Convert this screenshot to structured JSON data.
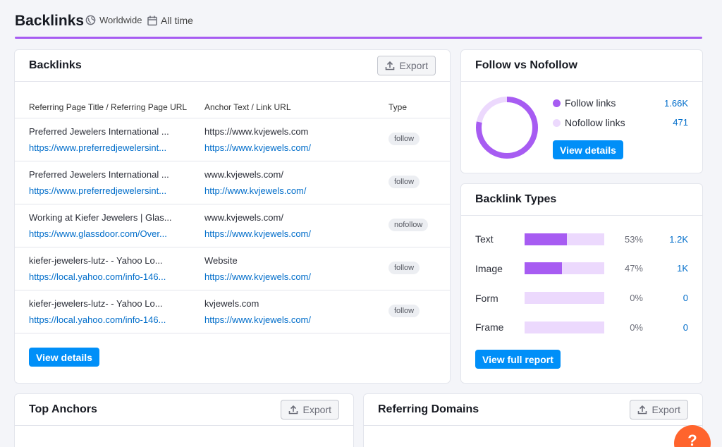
{
  "header": {
    "title": "Backlinks",
    "region": "Worldwide",
    "period": "All time"
  },
  "backlinks_card": {
    "title": "Backlinks",
    "export_label": "Export",
    "columns": [
      "Referring Page Title / Referring Page URL",
      "Anchor Text / Link URL",
      "Type"
    ],
    "rows": [
      {
        "title": "Preferred Jewelers International ...",
        "url": "https://www.preferredjewelersint...",
        "anchor": "https://www.kvjewels.com",
        "link": "https://www.kvjewels.com/",
        "type": "follow"
      },
      {
        "title": "Preferred Jewelers International ...",
        "url": "https://www.preferredjewelersint...",
        "anchor": "www.kvjewels.com/",
        "link": "http://www.kvjewels.com/",
        "type": "follow"
      },
      {
        "title": "Working at Kiefer Jewelers | Glas...",
        "url": "https://www.glassdoor.com/Over...",
        "anchor": "www.kvjewels.com/",
        "link": "https://www.kvjewels.com/",
        "type": "nofollow"
      },
      {
        "title": "kiefer-jewelers-lutz- - Yahoo Lo...",
        "url": "https://local.yahoo.com/info-146...",
        "anchor": "Website",
        "link": "https://www.kvjewels.com/",
        "type": "follow"
      },
      {
        "title": "kiefer-jewelers-lutz- - Yahoo Lo...",
        "url": "https://local.yahoo.com/info-146...",
        "anchor": "kvjewels.com",
        "link": "https://www.kvjewels.com/",
        "type": "follow"
      }
    ],
    "view_details_label": "View details"
  },
  "follow_card": {
    "title": "Follow vs Nofollow",
    "follow_label": "Follow links",
    "follow_value": "1.66K",
    "nofollow_label": "Nofollow links",
    "nofollow_value": "471",
    "follow_fraction": 0.78,
    "view_details_label": "View details"
  },
  "types_card": {
    "title": "Backlink Types",
    "items": [
      {
        "label": "Text",
        "pct": "53%",
        "value": "1.2K",
        "fraction": 0.53
      },
      {
        "label": "Image",
        "pct": "47%",
        "value": "1K",
        "fraction": 0.47
      },
      {
        "label": "Form",
        "pct": "0%",
        "value": "0",
        "fraction": 0
      },
      {
        "label": "Frame",
        "pct": "0%",
        "value": "0",
        "fraction": 0
      }
    ],
    "view_report_label": "View full report"
  },
  "anchors_card": {
    "title": "Top Anchors",
    "export_label": "Export"
  },
  "domains_card": {
    "title": "Referring Domains",
    "export_label": "Export"
  },
  "help": {
    "label": "?"
  },
  "colors": {
    "accent": "#a75cf2",
    "accent_light": "#ecd9fd",
    "link": "#006dca",
    "primary": "#008ff8",
    "help": "#ff642d"
  }
}
